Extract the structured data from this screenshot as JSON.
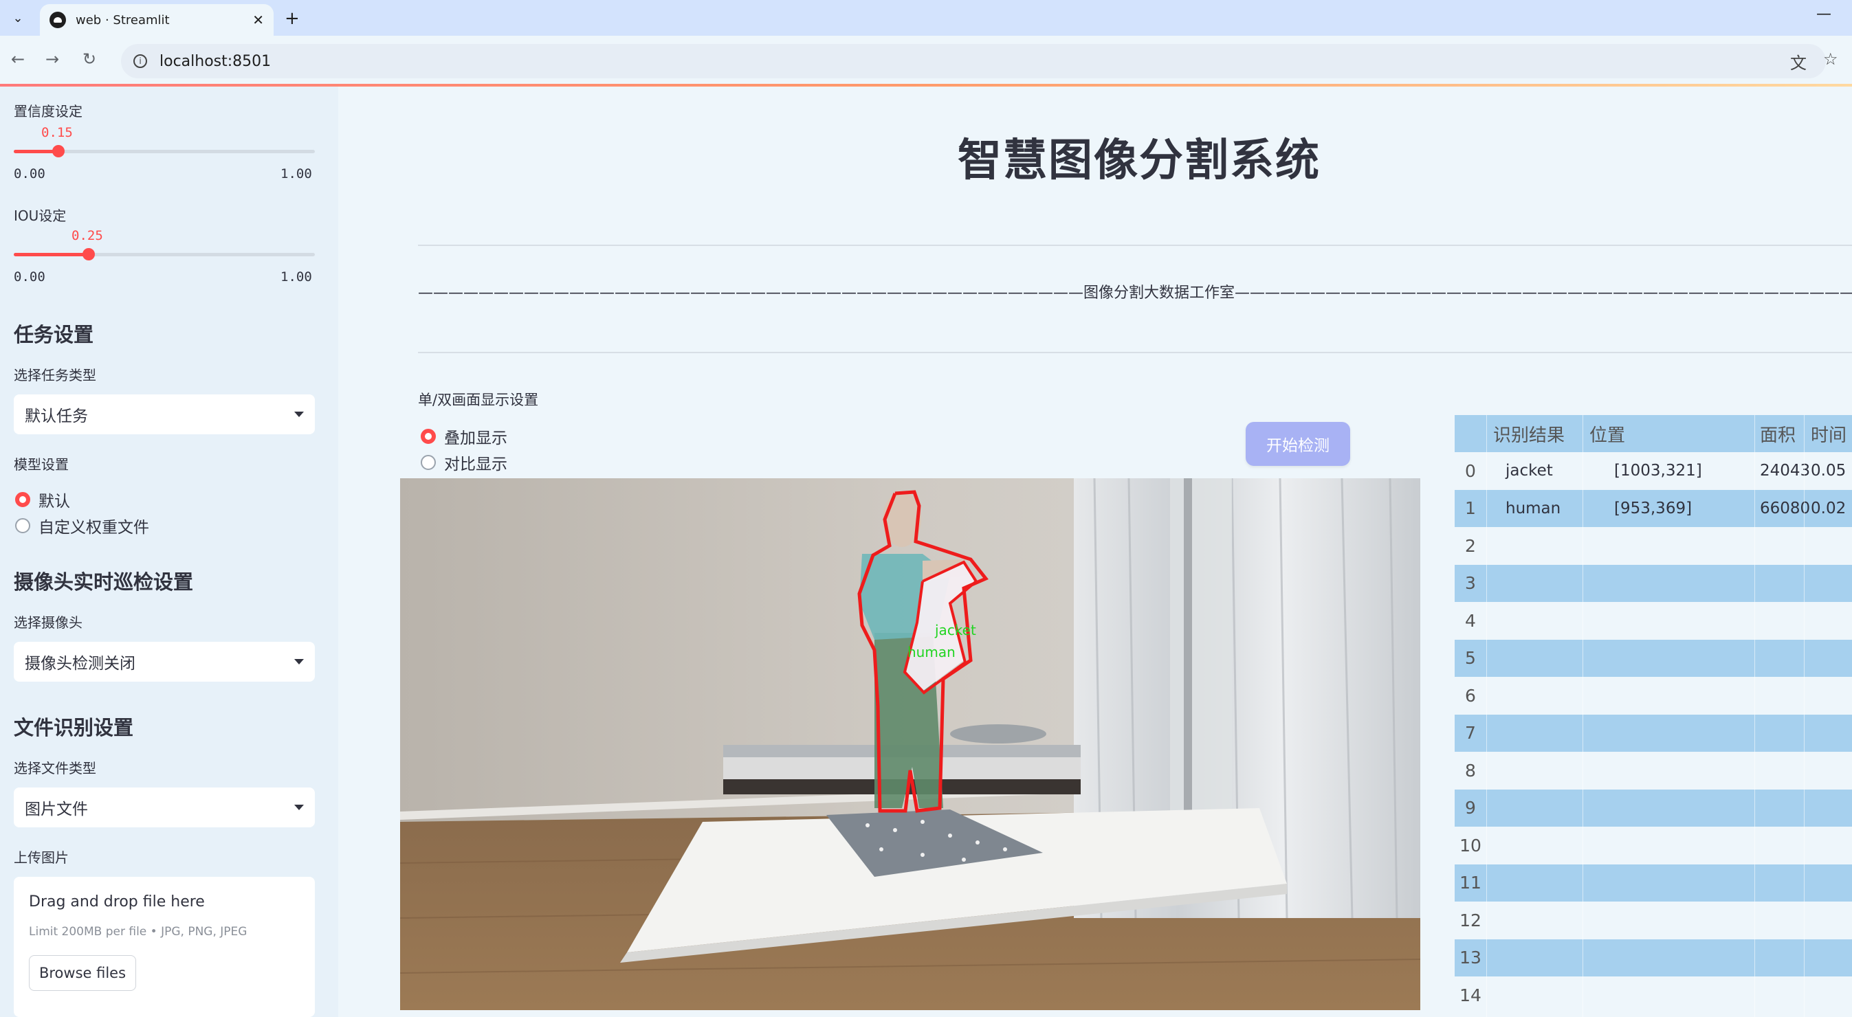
{
  "browser": {
    "tab_title": "web · Streamlit",
    "url": "localhost:8501"
  },
  "sidebar": {
    "confidence": {
      "label": "置信度设定",
      "value": "0.15",
      "value_fraction": 0.15,
      "min": "0.00",
      "max": "1.00"
    },
    "iou": {
      "label": "IOU设定",
      "value": "0.25",
      "value_fraction": 0.25,
      "min": "0.00",
      "max": "1.00"
    },
    "task_settings": {
      "heading": "任务设置",
      "select_label": "选择任务类型",
      "select_value": "默认任务"
    },
    "model_settings": {
      "label": "模型设置",
      "options": [
        "默认",
        "自定义权重文件"
      ],
      "selected_index": 0
    },
    "camera": {
      "heading": "摄像头实时巡检设置",
      "select_label": "选择摄像头",
      "select_value": "摄像头检测关闭"
    },
    "file": {
      "heading": "文件识别设置",
      "select_label": "选择文件类型",
      "select_value": "图片文件"
    },
    "upload": {
      "label": "上传图片",
      "drag_text": "Drag and drop file here",
      "limit_text": "Limit 200MB per file • JPG, PNG, JPEG",
      "browse_label": "Browse files"
    }
  },
  "main": {
    "title": "智慧图像分割系统",
    "divider_text": "————————————————————————————————————————————图像分割大数据工作室————————————————————————————————————————————",
    "display_label": "单/双画面显示设置",
    "display_options": [
      "叠加显示",
      "对比显示"
    ],
    "display_selected": 0,
    "start_button": "开始检测",
    "image_labels": [
      "jacket",
      "human"
    ]
  },
  "table": {
    "headers": [
      "识别结果",
      "位置",
      "面积",
      "时间"
    ],
    "rows": [
      {
        "index": "0",
        "result": "jacket",
        "position": "[1003,321]",
        "area": "24043",
        "time": "0.05"
      },
      {
        "index": "1",
        "result": "human",
        "position": "[953,369]",
        "area": "66080",
        "time": "0.02"
      },
      {
        "index": "2",
        "result": "",
        "position": "",
        "area": "",
        "time": ""
      },
      {
        "index": "3",
        "result": "",
        "position": "",
        "area": "",
        "time": ""
      },
      {
        "index": "4",
        "result": "",
        "position": "",
        "area": "",
        "time": ""
      },
      {
        "index": "5",
        "result": "",
        "position": "",
        "area": "",
        "time": ""
      },
      {
        "index": "6",
        "result": "",
        "position": "",
        "area": "",
        "time": ""
      },
      {
        "index": "7",
        "result": "",
        "position": "",
        "area": "",
        "time": ""
      },
      {
        "index": "8",
        "result": "",
        "position": "",
        "area": "",
        "time": ""
      },
      {
        "index": "9",
        "result": "",
        "position": "",
        "area": "",
        "time": ""
      },
      {
        "index": "10",
        "result": "",
        "position": "",
        "area": "",
        "time": ""
      },
      {
        "index": "11",
        "result": "",
        "position": "",
        "area": "",
        "time": ""
      },
      {
        "index": "12",
        "result": "",
        "position": "",
        "area": "",
        "time": ""
      },
      {
        "index": "13",
        "result": "",
        "position": "",
        "area": "",
        "time": ""
      },
      {
        "index": "14",
        "result": "",
        "position": "",
        "area": "",
        "time": ""
      }
    ]
  },
  "colors": {
    "accent": "#ff4b4b",
    "button": "#a8b2f4",
    "table_stripe": "#a6d0ee",
    "sidebar_bg": "#e7f1f9"
  }
}
